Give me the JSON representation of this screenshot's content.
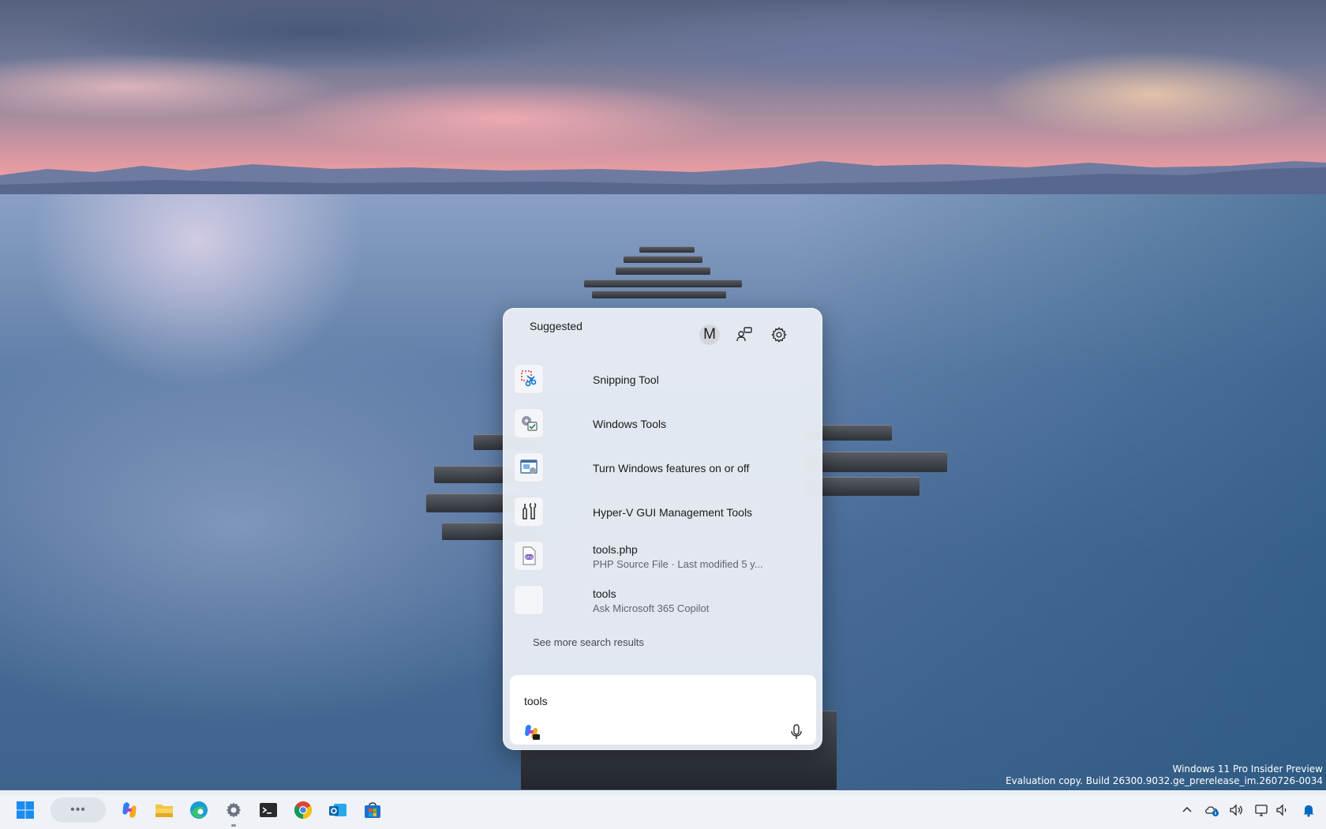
{
  "desktop": {
    "watermark_line1": "Windows 11 Pro Insider Preview",
    "watermark_line2": "Evaluation copy. Build 26300.9032.ge_prerelease_im.260726-0034"
  },
  "search_flyout": {
    "section_title": "Suggested",
    "account_initial": "M",
    "header_icons": [
      "account-avatar",
      "people-share-icon",
      "gear-icon"
    ],
    "results": [
      {
        "title": "Snipping Tool",
        "subtitle": "",
        "icon": "snipping-tool-icon"
      },
      {
        "title": "Windows Tools",
        "subtitle": "",
        "icon": "windows-tools-icon"
      },
      {
        "title": "Turn Windows features on or off",
        "subtitle": "",
        "icon": "windows-features-icon"
      },
      {
        "title": "Hyper-V GUI Management Tools",
        "subtitle": "",
        "icon": "hyperv-tools-icon"
      },
      {
        "title": "tools.php",
        "subtitle": "PHP Source File · Last modified 5 y...",
        "icon": "php-file-icon"
      },
      {
        "title": "tools",
        "subtitle": "Ask Microsoft 365 Copilot",
        "icon": "copilot-blank-icon"
      }
    ],
    "see_more_label": "See more search results",
    "search_value": "tools",
    "search_placeholder": ""
  },
  "taskbar": {
    "search_pill_glyph": "•••",
    "apps": [
      "start-icon",
      "copilot-icon",
      "file-explorer-icon",
      "edge-icon",
      "settings-icon",
      "terminal-icon",
      "chrome-icon",
      "outlook-icon",
      "store-icon"
    ],
    "tray": [
      "chevron-up-icon",
      "onedrive-icon",
      "volume-icon",
      "network-icon",
      "speaker-icon",
      "notification-bell-icon"
    ]
  },
  "colors": {
    "flyout_bg": "#e8ecf4",
    "accent_blue": "#0067c0"
  }
}
